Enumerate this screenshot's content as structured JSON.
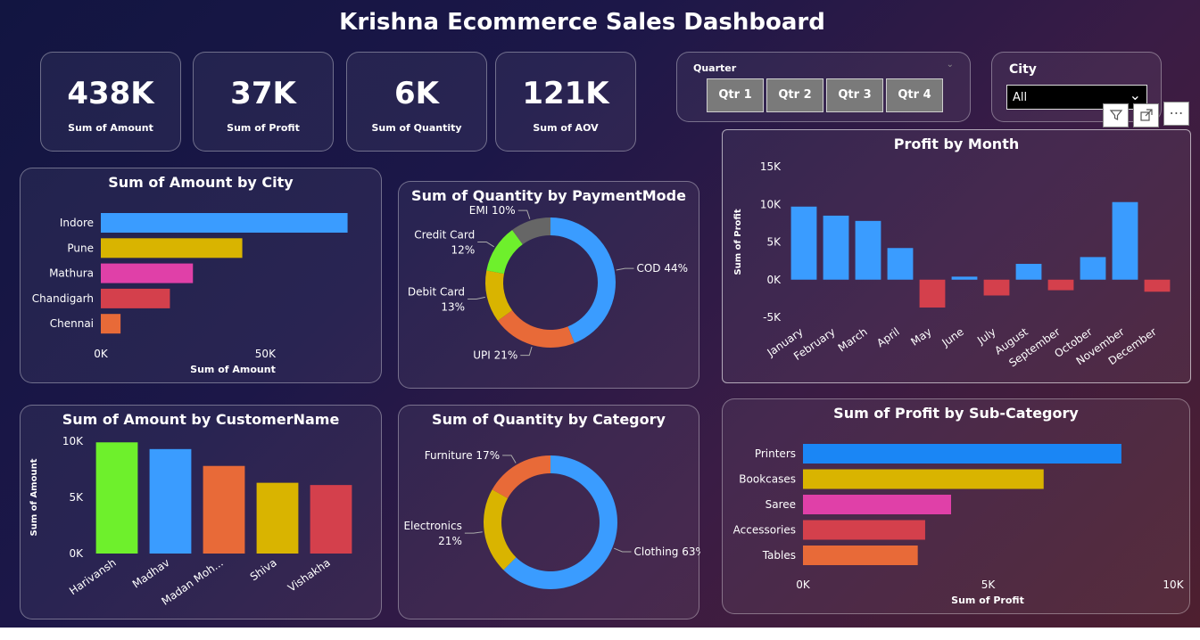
{
  "title": "Krishna Ecommerce Sales Dashboard",
  "kpis": [
    {
      "value": "438K",
      "label": "Sum of Amount"
    },
    {
      "value": "37K",
      "label": "Sum of Profit"
    },
    {
      "value": "6K",
      "label": "Sum of Quantity"
    },
    {
      "value": "121K",
      "label": "Sum of AOV"
    }
  ],
  "quarter_slicer": {
    "title": "Quarter",
    "options": [
      "Qtr 1",
      "Qtr 2",
      "Qtr 3",
      "Qtr 4"
    ]
  },
  "city_slicer": {
    "title": "City",
    "selected": "All"
  },
  "colors": {
    "blue": "#3a9cff",
    "gold": "#d9b400",
    "magenta": "#e040a8",
    "red": "#d4404c",
    "orange": "#e86a38",
    "green": "#6ef02c",
    "gray": "#666666",
    "deepblue": "#1a86f5"
  },
  "chart_data": [
    {
      "id": "amount-by-city",
      "type": "bar",
      "orientation": "horizontal",
      "title": "Sum of Amount by City",
      "categories": [
        "Indore",
        "Pune",
        "Mathura",
        "Chandigarh",
        "Chennai"
      ],
      "values": [
        75000,
        43000,
        28000,
        21000,
        6000
      ],
      "colors": [
        "#3a9cff",
        "#d9b400",
        "#e040a8",
        "#d4404c",
        "#e86a38"
      ],
      "xlabel": "Sum of Amount",
      "xticks": [
        "0K",
        "50K"
      ],
      "xlim": [
        0,
        80000
      ]
    },
    {
      "id": "quantity-by-paymentmode",
      "type": "pie",
      "donut": true,
      "title": "Sum of Quantity by PaymentMode",
      "labels": [
        "COD 44%",
        "UPI 21%",
        "Debit Card\n13%",
        "Credit Card\n12%",
        "EMI 10%"
      ],
      "values": [
        44,
        21,
        13,
        12,
        10
      ],
      "colors": [
        "#3a9cff",
        "#e86a38",
        "#d9b400",
        "#6ef02c",
        "#666666"
      ]
    },
    {
      "id": "profit-by-month",
      "type": "bar",
      "title": "Profit by Month",
      "categories": [
        "January",
        "February",
        "March",
        "April",
        "May",
        "June",
        "July",
        "August",
        "September",
        "October",
        "November",
        "December"
      ],
      "values": [
        9700,
        8500,
        7800,
        4200,
        -3700,
        400,
        -2100,
        2100,
        -1400,
        3000,
        10300,
        -1600
      ],
      "ylabel": "Sum of Profit",
      "ylim": [
        -5000,
        15000
      ],
      "yticks": [
        "-5K",
        "0K",
        "5K",
        "10K",
        "15K"
      ],
      "colors": {
        "positive": "#3a9cff",
        "negative": "#d4404c"
      }
    },
    {
      "id": "amount-by-customer",
      "type": "bar",
      "title": "Sum of Amount by CustomerName",
      "categories": [
        "Harivansh",
        "Madhav",
        "Madan Moh...",
        "Shiva",
        "Vishakha"
      ],
      "values": [
        9900,
        9300,
        7800,
        6300,
        6100
      ],
      "colors": [
        "#6ef02c",
        "#3a9cff",
        "#e86a38",
        "#d9b400",
        "#d4404c"
      ],
      "ylabel": "Sum of Amount",
      "ylim": [
        0,
        10000
      ],
      "yticks": [
        "0K",
        "5K",
        "10K"
      ]
    },
    {
      "id": "quantity-by-category",
      "type": "pie",
      "donut": true,
      "title": "Sum of Quantity by Category",
      "labels": [
        "Clothing 63%",
        "Electronics\n21%",
        "Furniture 17%"
      ],
      "values": [
        63,
        21,
        17
      ],
      "colors": [
        "#3a9cff",
        "#d9b400",
        "#e86a38"
      ]
    },
    {
      "id": "profit-by-subcategory",
      "type": "bar",
      "orientation": "horizontal",
      "title": "Sum of Profit by Sub-Category",
      "categories": [
        "Printers",
        "Bookcases",
        "Saree",
        "Accessories",
        "Tables"
      ],
      "values": [
        8600,
        6500,
        4000,
        3300,
        3100
      ],
      "colors": [
        "#1a86f5",
        "#d9b400",
        "#e040a8",
        "#d4404c",
        "#e86a38"
      ],
      "xlabel": "Sum of Profit",
      "xlim": [
        0,
        10000
      ],
      "xticks": [
        "0K",
        "5K",
        "10K"
      ]
    }
  ]
}
